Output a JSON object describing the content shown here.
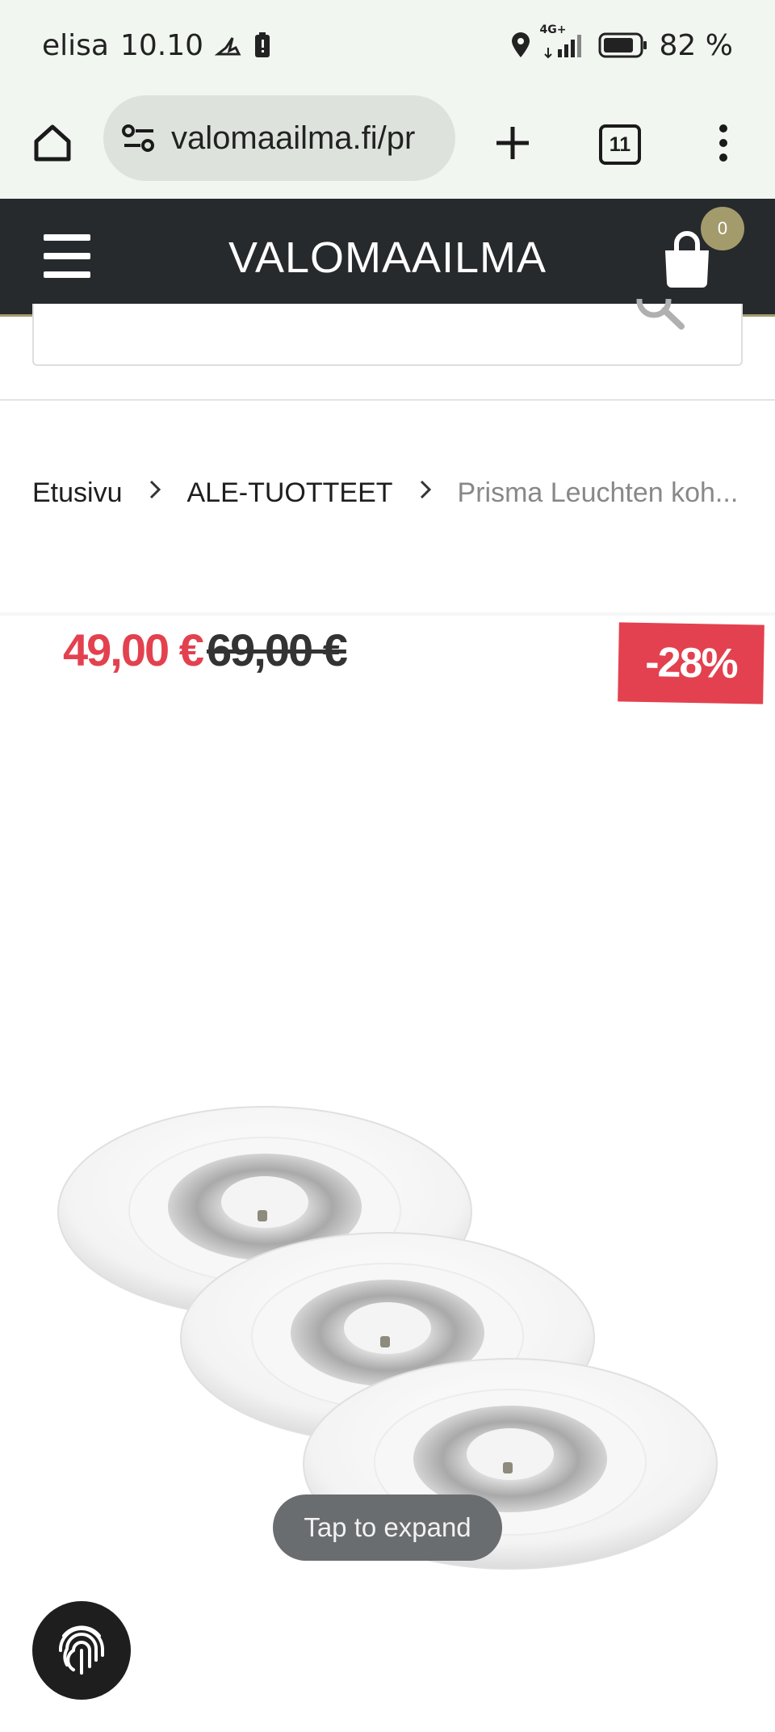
{
  "status_bar": {
    "carrier": "elisa",
    "time": "10.10",
    "network": "4G+",
    "battery": "82 %",
    "icons": [
      "activity-icon",
      "battery-alert-icon",
      "location-icon",
      "signal-icon",
      "battery-icon"
    ]
  },
  "browser": {
    "url": "valomaailma.fi/pr",
    "tab_count": "11",
    "icons": [
      "home-icon",
      "site-settings-icon",
      "new-tab-icon",
      "tab-switcher-icon",
      "more-menu-icon"
    ]
  },
  "site": {
    "logo": "VALOMAAILMA",
    "cart_count": "0",
    "icons": [
      "menu-icon",
      "cart-bag-icon",
      "search-icon"
    ]
  },
  "breadcrumb": {
    "home": "Etusivu",
    "category": "ALE-TUOTTEET",
    "current": "Prisma Leuchten koh..."
  },
  "product": {
    "price_now": "49,00 €",
    "price_old": "69,00 €",
    "discount": "-28%",
    "image": "three-recessed-downlights",
    "expand_hint": "Tap to expand"
  },
  "floating": {
    "icon": "fingerprint-icon"
  },
  "colors": {
    "sale_red": "#e3414f",
    "header_dark": "#262a2d",
    "accent_gold": "#a49b6c",
    "chrome_bg": "#f1f6f0"
  }
}
